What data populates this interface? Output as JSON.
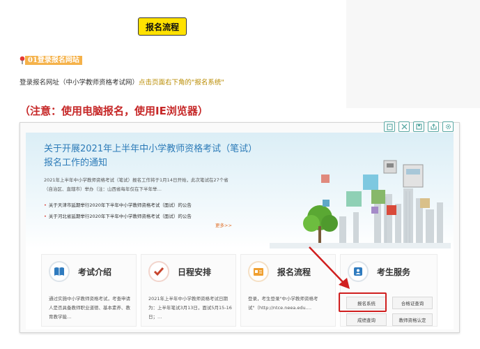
{
  "header": {
    "button_label": "报名流程"
  },
  "step": {
    "label": "01登录报名网站",
    "icon": "pin-icon"
  },
  "intro": {
    "text_plain": "登录报名网址（中小学教师资格考试网）",
    "text_highlight": "点击页面右下角的\"报名系统\""
  },
  "warning": {
    "text": "（注意：使用电脑报名，使用IE浏览器）"
  },
  "screenshot": {
    "toolbar_icons": [
      "bookmark-icon",
      "expand-icon",
      "save-icon",
      "share-icon",
      "settings-icon"
    ],
    "banner": {
      "title": "关于开展2021年上半年中小学教师资格考试（笔试）报名工作的通知",
      "description": "2021年上半年中小学教师资格考试（笔试）报名工作将于1月14日开始，此次笔试在27个省（自治区、直辖市）举办（注：山西省每年仅在下半年举…",
      "links": [
        "关于天津市延期举行2020年下半年中小学教师资格考试（面试）的公告",
        "关于河北省延期举行2020年下半年中小学教师资格考试（面试）的公告"
      ],
      "more": "更多>>"
    },
    "cards": [
      {
        "title": "考试介绍",
        "text": "通过实施中小学教师资格考试，考查申请人是否具备教师职业道德、基本素养、教育教学能…",
        "icon": "book-icon"
      },
      {
        "title": "日程安排",
        "text": "2021年上半年中小学教师资格考试日期为：上半年笔试3月13日，面试5月15-16日；…",
        "icon": "checkmark-icon"
      },
      {
        "title": "报名流程",
        "text": "登录，考生登录\"中小学教师资格考试\"（http://ntce.neea.edu.…",
        "icon": "form-icon"
      },
      {
        "title": "考生服务",
        "icon": "person-card-icon"
      }
    ],
    "services": {
      "register": "报名系统",
      "certificate_query": "合格证查询",
      "score_query": "成绩查询",
      "teacher_cert": "教师资格认定"
    }
  },
  "colors": {
    "accent_yellow": "#ffe100",
    "warning_red": "#c62828",
    "banner_blue": "#2c7bb8",
    "highlight_box": "#d01f1f"
  }
}
